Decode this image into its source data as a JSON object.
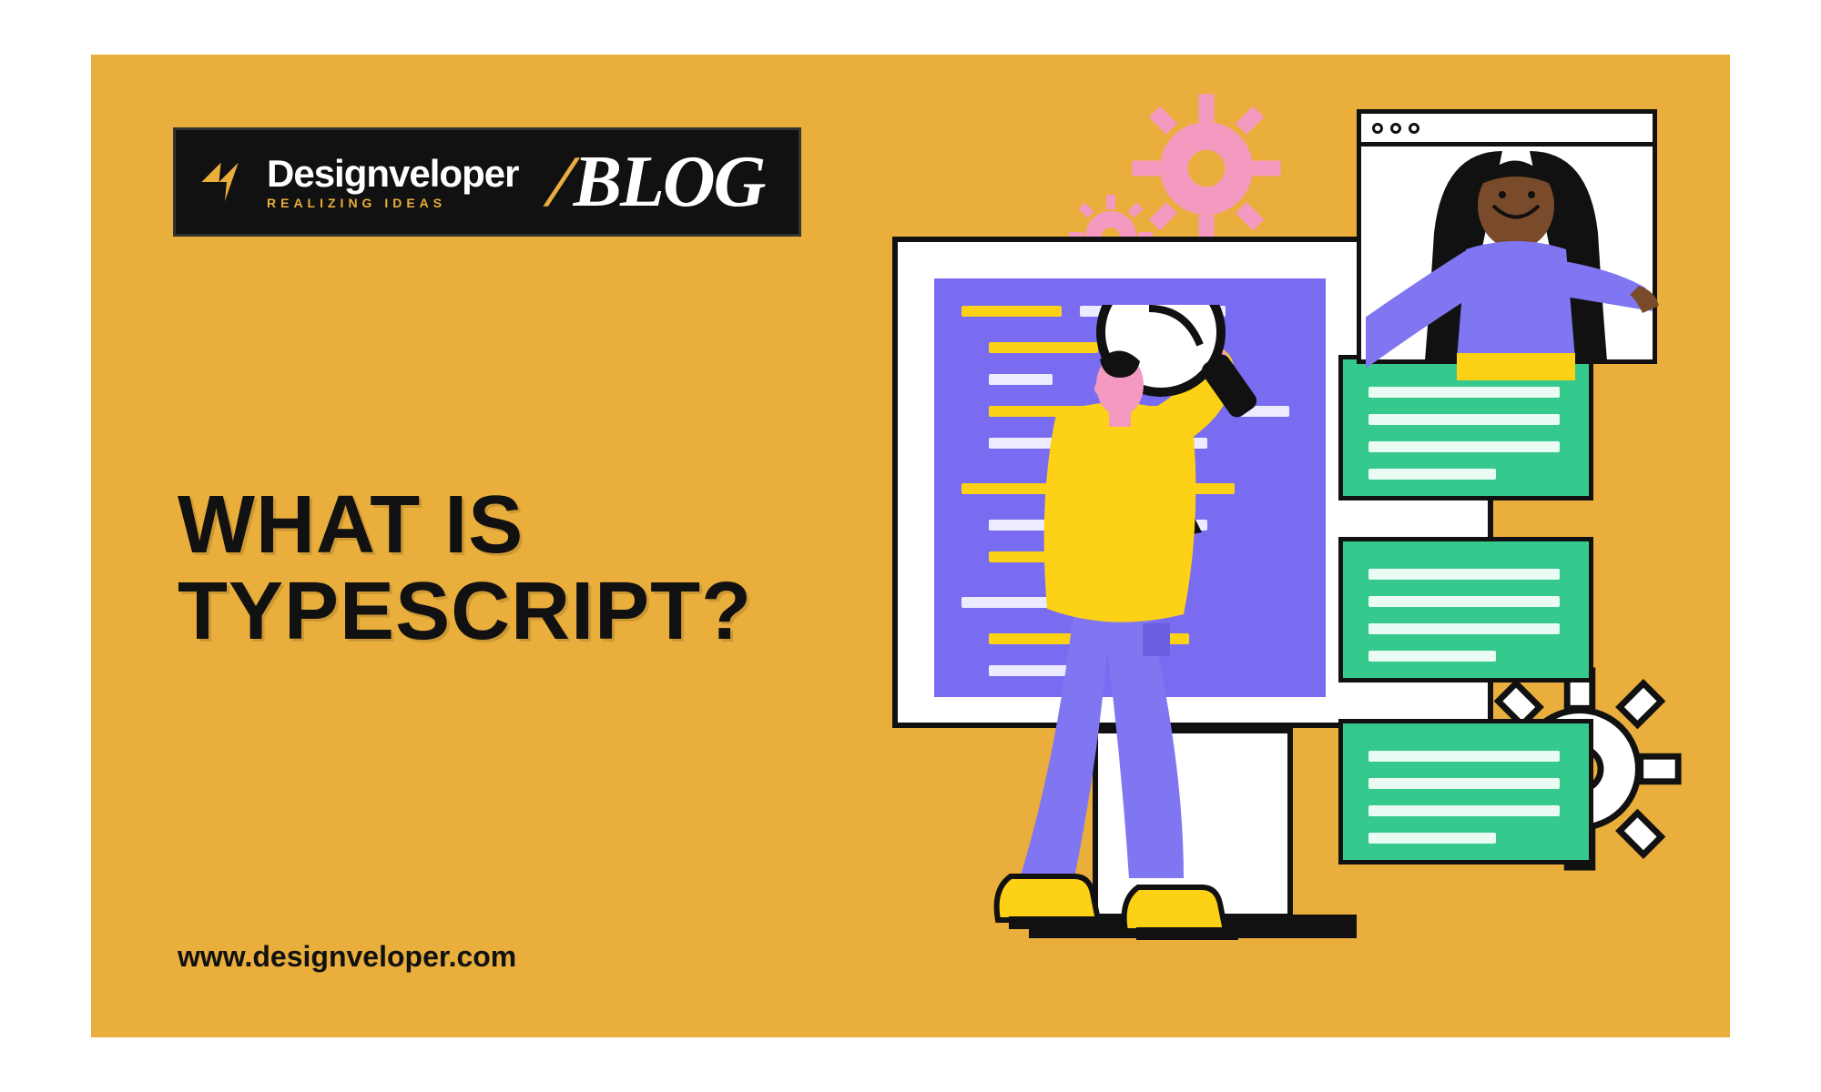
{
  "brand": {
    "name": "Designveloper",
    "tagline": "REALIZING IDEAS",
    "section": "BLOG"
  },
  "headline": "WHAT IS\nTYPESCRIPT?",
  "url": "www.designveloper.com",
  "colors": {
    "bg": "#E9AE3C",
    "dark": "#111111",
    "purple": "#7A6CF0",
    "green": "#36C98E",
    "pink": "#F49AC1",
    "yellow": "#FCD116"
  },
  "illustration": {
    "gears": [
      {
        "name": "gear-pink-large",
        "color": "#F49AC1"
      },
      {
        "name": "gear-pink-small",
        "color": "#F49AC1"
      },
      {
        "name": "gear-white-large",
        "color": "#FFFFFF"
      }
    ],
    "cards": 3,
    "mini_window_dots": 3
  }
}
